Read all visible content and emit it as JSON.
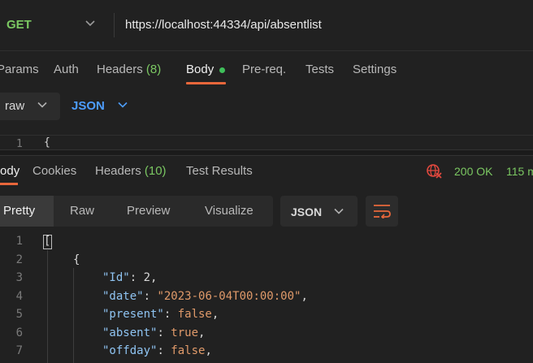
{
  "request": {
    "method": "GET",
    "url": "https://localhost:44334/api/absentlist"
  },
  "request_tabs": [
    {
      "label": "Params",
      "count": ""
    },
    {
      "label": "Auth",
      "count": ""
    },
    {
      "label": "Headers",
      "count": "(8)"
    },
    {
      "label": "Body",
      "count": ""
    },
    {
      "label": "Pre-req.",
      "count": ""
    },
    {
      "label": "Tests",
      "count": ""
    },
    {
      "label": "Settings",
      "count": ""
    }
  ],
  "body_mode": {
    "mode": "raw",
    "type": "JSON"
  },
  "request_editor": {
    "line_number": "1",
    "content": "{"
  },
  "response_tabs": [
    {
      "label": "Body",
      "count": ""
    },
    {
      "label": "Cookies",
      "count": ""
    },
    {
      "label": "Headers",
      "count": "(10)"
    },
    {
      "label": "Test Results",
      "count": ""
    }
  ],
  "response_status": {
    "code": "200 OK",
    "time": "115 m"
  },
  "response_views": [
    "Pretty",
    "Raw",
    "Preview",
    "Visualize"
  ],
  "response_language": "JSON",
  "colors": {
    "accent": "#e8673b",
    "success": "#7bc862",
    "json_type": "#4d9dff"
  },
  "code_lines": [
    {
      "n": "1",
      "tokens": [
        {
          "t": "[",
          "c": "p"
        }
      ]
    },
    {
      "n": "2",
      "tokens": [
        {
          "t": "{",
          "c": "p"
        }
      ]
    },
    {
      "n": "3",
      "tokens": [
        {
          "t": "\"Id\"",
          "c": "key"
        },
        {
          "t": ": ",
          "c": "p"
        },
        {
          "t": "2",
          "c": "num"
        },
        {
          "t": ",",
          "c": "p"
        }
      ]
    },
    {
      "n": "4",
      "tokens": [
        {
          "t": "\"date\"",
          "c": "key"
        },
        {
          "t": ": ",
          "c": "p"
        },
        {
          "t": "\"2023-06-04T00:00:00\"",
          "c": "str"
        },
        {
          "t": ",",
          "c": "p"
        }
      ]
    },
    {
      "n": "5",
      "tokens": [
        {
          "t": "\"present\"",
          "c": "key"
        },
        {
          "t": ": ",
          "c": "p"
        },
        {
          "t": "false",
          "c": "lit"
        },
        {
          "t": ",",
          "c": "p"
        }
      ]
    },
    {
      "n": "6",
      "tokens": [
        {
          "t": "\"absent\"",
          "c": "key"
        },
        {
          "t": ": ",
          "c": "p"
        },
        {
          "t": "true",
          "c": "lit"
        },
        {
          "t": ",",
          "c": "p"
        }
      ]
    },
    {
      "n": "7",
      "tokens": [
        {
          "t": "\"offday\"",
          "c": "key"
        },
        {
          "t": ": ",
          "c": "p"
        },
        {
          "t": "false",
          "c": "lit"
        },
        {
          "t": ",",
          "c": "p"
        }
      ]
    }
  ]
}
